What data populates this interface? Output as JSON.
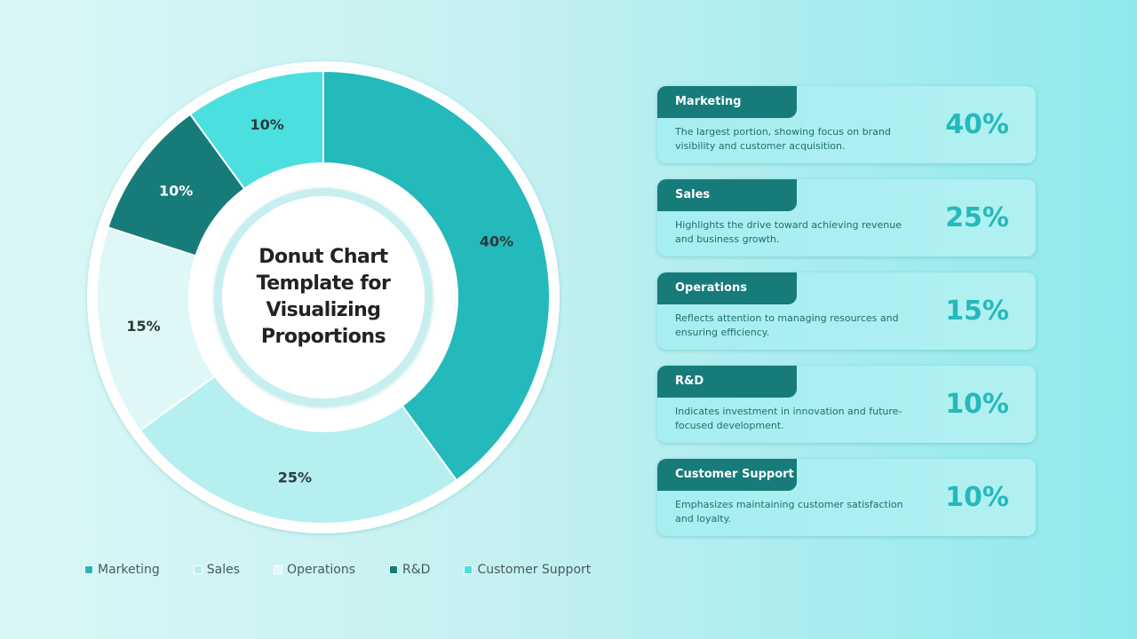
{
  "chart_data": {
    "type": "pie",
    "variant": "donut",
    "title": "Donut Chart Template for Visualizing Proportions",
    "categories": [
      "Marketing",
      "Sales",
      "Operations",
      "R&D",
      "Customer Support"
    ],
    "values": [
      40,
      25,
      15,
      10,
      10
    ],
    "labels": [
      "40%",
      "25%",
      "15%",
      "10%",
      "10%"
    ],
    "colors": [
      "#24b9ba",
      "#b5eff0",
      "#e0f7f7",
      "#177b7a",
      "#4cdfdf"
    ],
    "label_colors": [
      "#2b3a3c",
      "#2b3a3c",
      "#2b3a3c",
      "#ffffff",
      "#2b3a3c"
    ],
    "start": "top",
    "direction": "clockwise",
    "legend_position": "bottom"
  },
  "center": {
    "title": "Donut Chart Template for Visualizing Proportions",
    "lines": [
      "Donut Chart",
      "Template for",
      "Visualizing",
      "Proportions"
    ]
  },
  "legend": [
    {
      "label": "Marketing",
      "color": "#24b9ba"
    },
    {
      "label": "Sales",
      "color": "#b5eff0"
    },
    {
      "label": "Operations",
      "color": "#e0f7f7"
    },
    {
      "label": "R&D",
      "color": "#177b7a"
    },
    {
      "label": "Customer Support",
      "color": "#4cdfdf"
    }
  ],
  "cards": [
    {
      "title": "Marketing",
      "description": "The largest portion, showing focus on brand visibility and customer acquisition.",
      "value": "40%"
    },
    {
      "title": "Sales",
      "description": "Highlights the drive toward achieving revenue and business growth.",
      "value": "25%"
    },
    {
      "title": "Operations",
      "description": "Reflects attention to managing resources and ensuring efficiency.",
      "value": "15%"
    },
    {
      "title": "R&D",
      "description": "Indicates investment in innovation and future-focused development.",
      "value": "10%"
    },
    {
      "title": "Customer Support",
      "description": "Emphasizes maintaining customer satisfaction and loyalty.",
      "value": "10%"
    }
  ],
  "colors": {
    "accent": "#24b9ba",
    "dark": "#177b7a",
    "text_dark": "#222222"
  }
}
